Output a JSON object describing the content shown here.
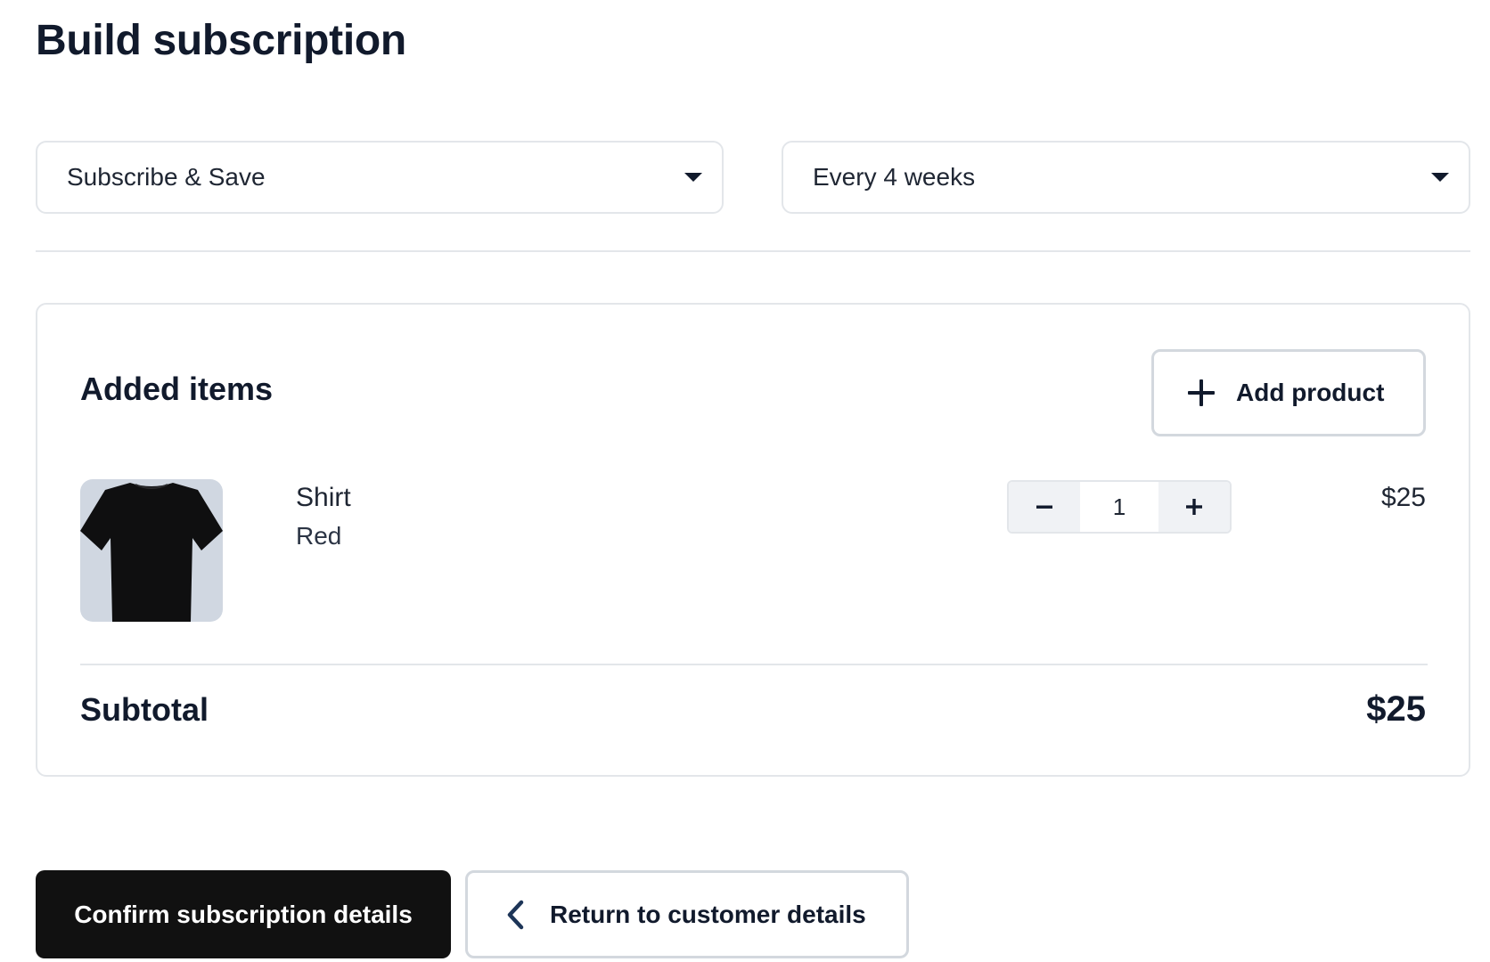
{
  "page": {
    "title": "Build subscription"
  },
  "selects": {
    "plan": {
      "value": "Subscribe & Save",
      "icon": "chevron-down-icon"
    },
    "frequency": {
      "value": "Every 4 weeks",
      "icon": "chevron-down-icon"
    }
  },
  "items": {
    "heading": "Added items",
    "add_product_label": "Add product",
    "list": [
      {
        "name": "Shirt",
        "variant": "Red",
        "quantity": "1",
        "price": "$25",
        "image": "black-tshirt-image"
      }
    ],
    "subtotal_label": "Subtotal",
    "subtotal_value": "$25"
  },
  "actions": {
    "confirm_label": "Confirm subscription details",
    "return_label": "Return to customer details"
  },
  "colors": {
    "text": "#111a2c",
    "border": "#e3e6ea",
    "primary_button": "#111111",
    "thumb_bg": "#d0d7e1"
  }
}
